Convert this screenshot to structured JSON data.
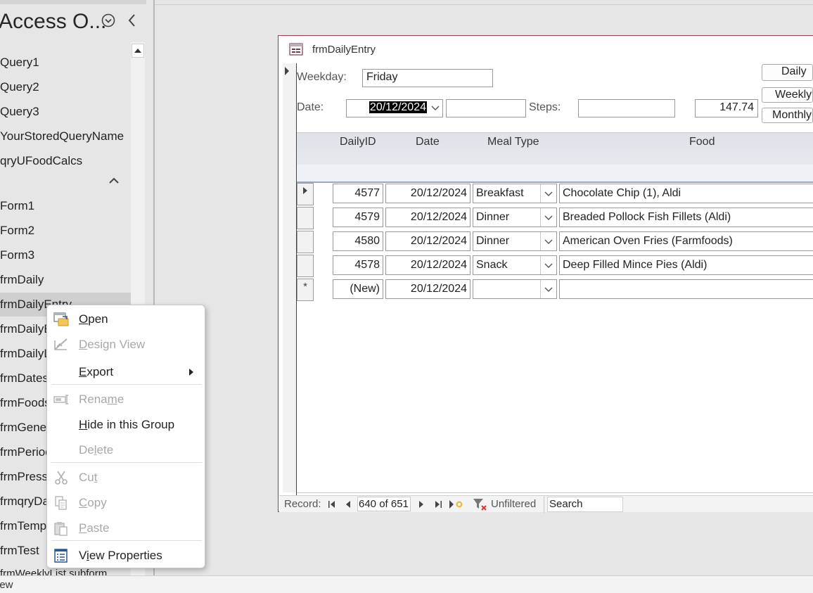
{
  "nav_pane": {
    "title": "Access O...",
    "items": [
      {
        "label": "Query1",
        "selected": false
      },
      {
        "label": "Query2",
        "selected": false
      },
      {
        "label": "Query3",
        "selected": false
      },
      {
        "label": "YourStoredQueryName",
        "selected": false
      },
      {
        "label": "qryUFoodCalcs",
        "selected": false
      },
      {
        "label": "Form1",
        "selected": false
      },
      {
        "label": "Form2",
        "selected": false
      },
      {
        "label": "Form3",
        "selected": false
      },
      {
        "label": "frmDaily",
        "selected": false
      },
      {
        "label": "frmDailyEntry",
        "selected": true
      },
      {
        "label": "frmDailyE",
        "selected": false
      },
      {
        "label": "frmDailyL",
        "selected": false
      },
      {
        "label": "frmDates",
        "selected": false
      },
      {
        "label": "frmFoods",
        "selected": false
      },
      {
        "label": "frmGener",
        "selected": false
      },
      {
        "label": "frmPeriod",
        "selected": false
      },
      {
        "label": "frmPressu",
        "selected": false
      },
      {
        "label": "frmqryDa",
        "selected": false
      },
      {
        "label": "frmTemp",
        "selected": false
      },
      {
        "label": "frmTest",
        "selected": false
      },
      {
        "label": "frmWeeklyList subform",
        "selected": false
      }
    ]
  },
  "form": {
    "title": "frmDailyEntry",
    "weekday_label": "Weekday:",
    "weekday_value": "Friday",
    "date_label": "Date:",
    "date_value": "20/12/2024",
    "date_extra_value": "",
    "steps_label": "Steps:",
    "steps_value": "",
    "total_value": "147.74",
    "buttons": {
      "daily": "Daily",
      "weekly": "Weekly",
      "monthly": "Monthly"
    },
    "columns": {
      "daily_id": "DailyID",
      "date": "Date",
      "meal_type": "Meal Type",
      "food": "Food"
    },
    "rows": [
      {
        "daily_id": "4577",
        "date": "20/12/2024",
        "meal_type": "Breakfast",
        "food": "Chocolate Chip (1), Aldi"
      },
      {
        "daily_id": "4579",
        "date": "20/12/2024",
        "meal_type": "Dinner",
        "food": "Breaded Pollock Fish Fillets (Aldi)"
      },
      {
        "daily_id": "4580",
        "date": "20/12/2024",
        "meal_type": "Dinner",
        "food": "American Oven Fries (Farmfoods)"
      },
      {
        "daily_id": "4578",
        "date": "20/12/2024",
        "meal_type": "Snack",
        "food": "Deep Filled Mince Pies (Aldi)"
      }
    ],
    "new_row": {
      "marker": "*",
      "daily_id": "(New)",
      "date": "20/12/2024",
      "meal_type": "",
      "food": ""
    }
  },
  "record_nav": {
    "label": "Record:",
    "position": "640 of 651",
    "filter": "Unfiltered",
    "search_placeholder": "Search"
  },
  "context_menu": {
    "items": [
      {
        "label": "Open",
        "mnemonic": "O",
        "icon": "open-form-icon",
        "enabled": true
      },
      {
        "label": "Design View",
        "mnemonic": "D",
        "icon": "design-view-icon",
        "enabled": false
      },
      {
        "label": "Export",
        "mnemonic": "E",
        "icon": "",
        "enabled": true,
        "submenu": true
      },
      {
        "label": "Rename",
        "mnemonic": "m",
        "icon": "rename-icon",
        "enabled": false
      },
      {
        "label": "Hide in this Group",
        "mnemonic": "H",
        "icon": "",
        "enabled": true
      },
      {
        "label": "Delete",
        "mnemonic": "l",
        "icon": "",
        "enabled": false
      },
      {
        "label": "Cut",
        "mnemonic": "t",
        "icon": "scissors-icon",
        "enabled": false
      },
      {
        "label": "Copy",
        "mnemonic": "C",
        "icon": "copy-icon",
        "enabled": false
      },
      {
        "label": "Paste",
        "mnemonic": "P",
        "icon": "paste-icon",
        "enabled": false
      },
      {
        "label": "View Properties",
        "mnemonic": "i",
        "icon": "properties-icon",
        "enabled": true
      }
    ]
  },
  "status_bar": {
    "text": "iew"
  },
  "colors": {
    "form_border": "#a23b4b",
    "selection_bg": "#cfcfcf",
    "header_grad": "#dfe2e8",
    "accent_blue": "#2b579a"
  }
}
